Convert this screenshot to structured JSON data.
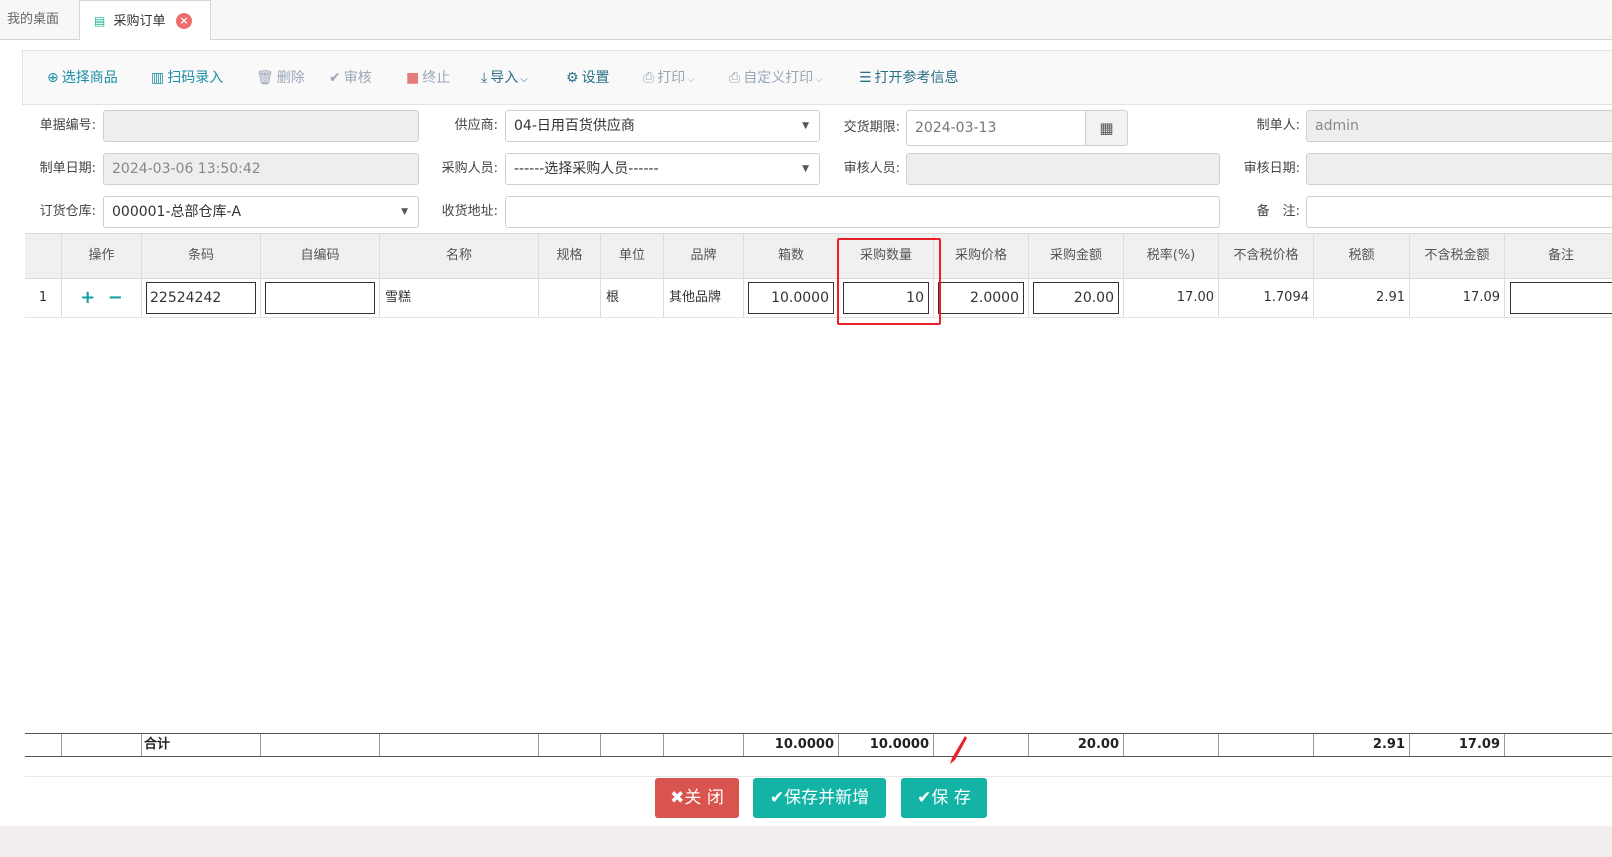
{
  "tabs": {
    "home": "我的桌面",
    "active": "采购订单"
  },
  "toolbar": {
    "select_goods": "选择商品",
    "scan_entry": "扫码录入",
    "delete": "删除",
    "review": "审核",
    "terminate": "终止",
    "import": "导入",
    "settings": "设置",
    "print": "打印",
    "custom_print": "自定义打印",
    "open_reference": "打开参考信息"
  },
  "form": {
    "doc_no_label": "单据编号:",
    "doc_no_value": "",
    "supplier_label": "供应商:",
    "supplier_value": "04-日用百货供应商",
    "delivery_label": "交货期限:",
    "delivery_value": "2024-03-13",
    "maker_label": "制单人:",
    "maker_value": "admin",
    "make_date_label": "制单日期:",
    "make_date_value": "2024-03-06 13:50:42",
    "buyer_label": "采购人员:",
    "buyer_value": "------选择采购人员------",
    "reviewer_label": "审核人员:",
    "reviewer_value": "",
    "review_date_label": "审核日期:",
    "review_date_value": "",
    "warehouse_label": "订货仓库:",
    "warehouse_value": "000001-总部仓库-A",
    "address_label": "收货地址:",
    "address_value": "",
    "remark_label": "备　注:",
    "remark_value": ""
  },
  "table": {
    "headers": {
      "op": "操作",
      "barcode": "条码",
      "selfcode": "自编码",
      "name": "名称",
      "spec": "规格",
      "unit": "单位",
      "brand": "品牌",
      "boxes": "箱数",
      "qty": "采购数量",
      "price": "采购价格",
      "amount": "采购金额",
      "tax_rate": "税率(%)",
      "ex_price": "不含税价格",
      "tax": "税额",
      "ex_amount": "不含税金额",
      "remark": "备注"
    },
    "row": {
      "idx": "1",
      "barcode": "22524242",
      "selfcode": "",
      "name": "雪糕",
      "spec": "",
      "unit": "根",
      "brand": "其他品牌",
      "boxes": "10.0000",
      "qty": "10",
      "price": "2.0000",
      "amount": "20.00",
      "tax_rate": "17.00",
      "ex_price": "1.7094",
      "tax": "2.91",
      "ex_amount": "17.09",
      "remark": ""
    },
    "summary": {
      "label": "合计",
      "boxes": "10.0000",
      "qty": "10.0000",
      "amount": "20.00",
      "tax": "2.91",
      "ex_amount": "17.09"
    }
  },
  "buttons": {
    "close": "关 闭",
    "save_new": "保存并新增",
    "save": "保 存"
  },
  "colors": {
    "teal": "#13b4a6",
    "danger": "#d9534f",
    "highlight": "#e8202a"
  }
}
